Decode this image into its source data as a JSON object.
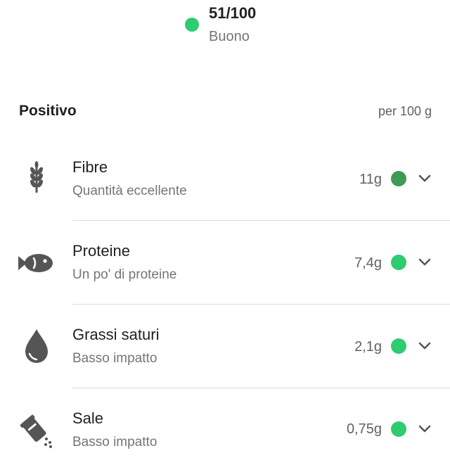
{
  "score": {
    "value": "51/100",
    "label": "Buono",
    "color": "#2ecc71"
  },
  "section": {
    "title": "Positivo",
    "unit": "per 100 g"
  },
  "nutrients": [
    {
      "name": "Fibre",
      "description": "Quantità eccellente",
      "amount": "11g",
      "level_color": "#3f9a55",
      "icon": "wheat-icon"
    },
    {
      "name": "Proteine",
      "description": "Un po' di proteine",
      "amount": "7,4g",
      "level_color": "#2ecc71",
      "icon": "fish-icon"
    },
    {
      "name": "Grassi saturi",
      "description": "Basso impatto",
      "amount": "2,1g",
      "level_color": "#2ecc71",
      "icon": "drop-icon"
    },
    {
      "name": "Sale",
      "description": "Basso impatto",
      "amount": "0,75g",
      "level_color": "#2ecc71",
      "icon": "salt-shaker-icon"
    }
  ],
  "colors": {
    "icon": "#555555",
    "chevron": "#555555"
  }
}
